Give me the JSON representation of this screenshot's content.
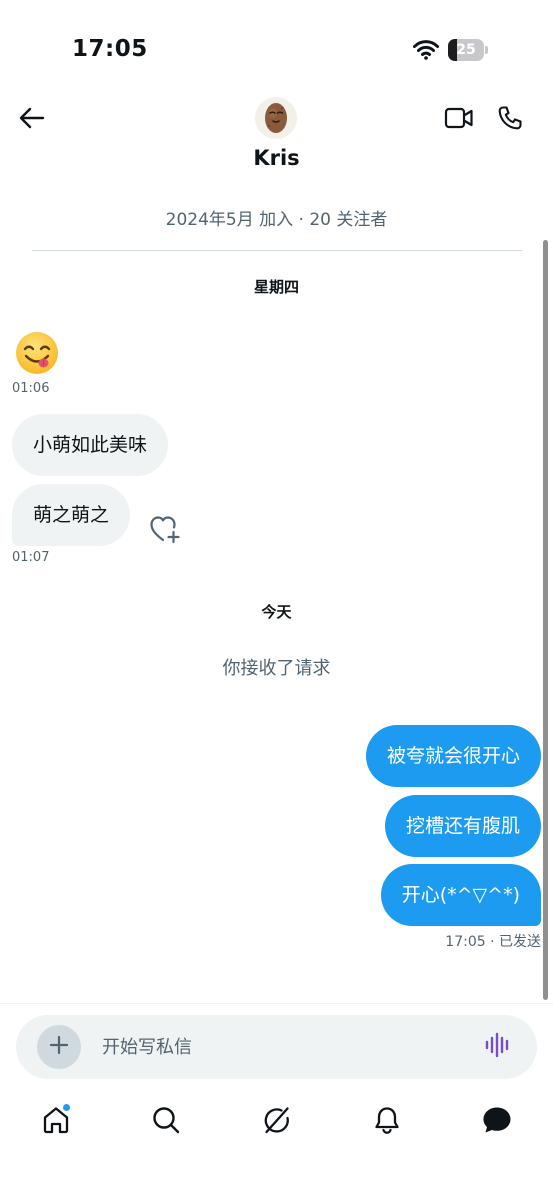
{
  "status_bar": {
    "time": "17:05",
    "battery": "25",
    "battery_level": 0.25
  },
  "header": {
    "contact_name": "Kris",
    "profile_meta": "2024年5月 加入 · 20 关注者"
  },
  "conversation": {
    "day_1": "星期四",
    "emoji_time": "01:06",
    "incoming": [
      {
        "text": "小萌如此美味"
      },
      {
        "text": "萌之萌之"
      }
    ],
    "incoming_time": "01:07",
    "day_2": "今天",
    "system_message": "你接收了请求",
    "outgoing": [
      {
        "text": "被夸就会很开心"
      },
      {
        "text": "挖槽还有腹肌"
      },
      {
        "text": "开心(*^▽^*)"
      }
    ],
    "sent_status": "17:05 · 已发送"
  },
  "composer": {
    "placeholder": "开始写私信",
    "value": ""
  },
  "icons": {
    "back": "arrow-left-icon",
    "video": "video-camera-icon",
    "phone": "phone-icon",
    "react": "heart-plus-icon",
    "attach": "plus-icon",
    "voice": "audio-wave-icon",
    "tabs": [
      "home-icon",
      "search-icon",
      "grok-icon",
      "bell-icon",
      "messages-icon"
    ]
  },
  "colors": {
    "accent": "#1d9bf0",
    "bubble_in": "#eff3f4",
    "voice_icon": "#794bc4"
  }
}
